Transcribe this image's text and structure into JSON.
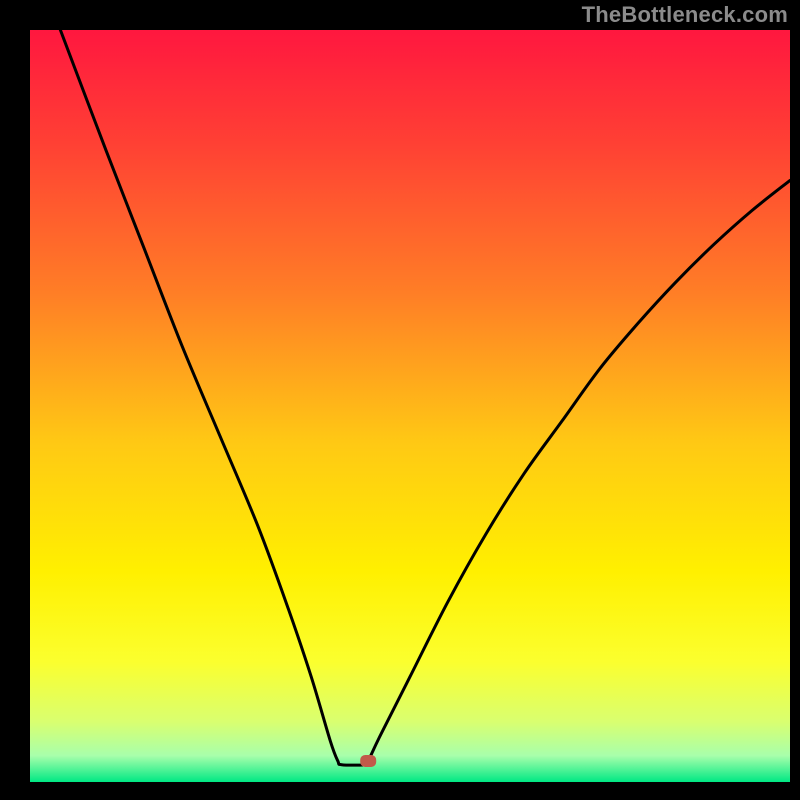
{
  "watermark": "TheBottleneck.com",
  "chart_data": {
    "type": "line",
    "title": "",
    "xlabel": "",
    "ylabel": "",
    "xlim": [
      0,
      100
    ],
    "ylim": [
      0,
      100
    ],
    "series": [
      {
        "name": "curve",
        "x": [
          4,
          10,
          15,
          20,
          25,
          30,
          34,
          37,
          39.5,
          40.5,
          41,
          44,
          44.5,
          46,
          50,
          55,
          60,
          65,
          70,
          75,
          80,
          85,
          90,
          95,
          100
        ],
        "values": [
          100,
          84,
          71,
          58,
          46,
          34,
          23,
          14,
          5.5,
          2.8,
          2.3,
          2.3,
          2.8,
          6,
          14,
          24,
          33,
          41,
          48,
          55,
          61,
          66.5,
          71.5,
          76,
          80
        ]
      }
    ],
    "marker": {
      "x": 44.5,
      "y": 2.8
    },
    "gradient_stops": [
      {
        "offset": 0.0,
        "color": "#ff173f"
      },
      {
        "offset": 0.15,
        "color": "#ff4034"
      },
      {
        "offset": 0.35,
        "color": "#ff7e26"
      },
      {
        "offset": 0.55,
        "color": "#ffc914"
      },
      {
        "offset": 0.72,
        "color": "#fff000"
      },
      {
        "offset": 0.84,
        "color": "#fbff2e"
      },
      {
        "offset": 0.92,
        "color": "#d9ff70"
      },
      {
        "offset": 0.965,
        "color": "#a8ffab"
      },
      {
        "offset": 1.0,
        "color": "#00e884"
      }
    ],
    "plot_bg": "#000000",
    "line_color": "#000000",
    "marker_color": "#c1594a"
  }
}
